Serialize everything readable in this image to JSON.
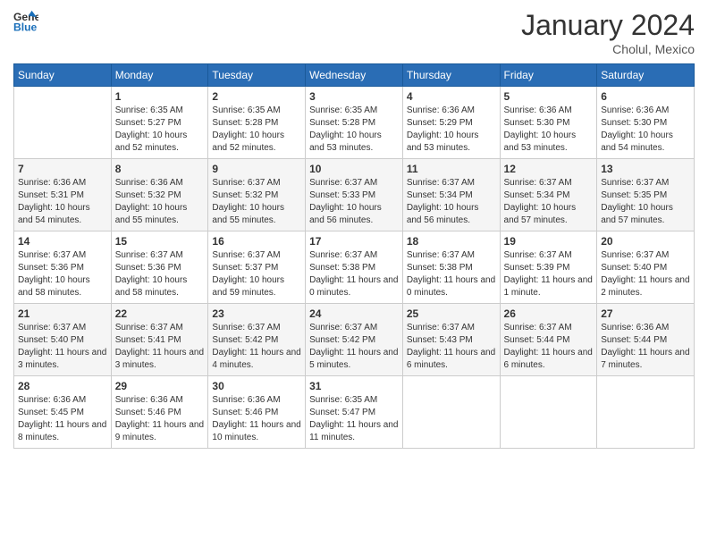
{
  "logo": {
    "general": "General",
    "blue": "Blue"
  },
  "title": {
    "month": "January 2024",
    "location": "Cholul, Mexico"
  },
  "weekdays": [
    "Sunday",
    "Monday",
    "Tuesday",
    "Wednesday",
    "Thursday",
    "Friday",
    "Saturday"
  ],
  "weeks": [
    [
      {
        "day": "",
        "empty": true
      },
      {
        "day": "1",
        "sunrise": "Sunrise: 6:35 AM",
        "sunset": "Sunset: 5:27 PM",
        "daylight": "Daylight: 10 hours and 52 minutes."
      },
      {
        "day": "2",
        "sunrise": "Sunrise: 6:35 AM",
        "sunset": "Sunset: 5:28 PM",
        "daylight": "Daylight: 10 hours and 52 minutes."
      },
      {
        "day": "3",
        "sunrise": "Sunrise: 6:35 AM",
        "sunset": "Sunset: 5:28 PM",
        "daylight": "Daylight: 10 hours and 53 minutes."
      },
      {
        "day": "4",
        "sunrise": "Sunrise: 6:36 AM",
        "sunset": "Sunset: 5:29 PM",
        "daylight": "Daylight: 10 hours and 53 minutes."
      },
      {
        "day": "5",
        "sunrise": "Sunrise: 6:36 AM",
        "sunset": "Sunset: 5:30 PM",
        "daylight": "Daylight: 10 hours and 53 minutes."
      },
      {
        "day": "6",
        "sunrise": "Sunrise: 6:36 AM",
        "sunset": "Sunset: 5:30 PM",
        "daylight": "Daylight: 10 hours and 54 minutes."
      }
    ],
    [
      {
        "day": "7",
        "sunrise": "Sunrise: 6:36 AM",
        "sunset": "Sunset: 5:31 PM",
        "daylight": "Daylight: 10 hours and 54 minutes."
      },
      {
        "day": "8",
        "sunrise": "Sunrise: 6:36 AM",
        "sunset": "Sunset: 5:32 PM",
        "daylight": "Daylight: 10 hours and 55 minutes."
      },
      {
        "day": "9",
        "sunrise": "Sunrise: 6:37 AM",
        "sunset": "Sunset: 5:32 PM",
        "daylight": "Daylight: 10 hours and 55 minutes."
      },
      {
        "day": "10",
        "sunrise": "Sunrise: 6:37 AM",
        "sunset": "Sunset: 5:33 PM",
        "daylight": "Daylight: 10 hours and 56 minutes."
      },
      {
        "day": "11",
        "sunrise": "Sunrise: 6:37 AM",
        "sunset": "Sunset: 5:34 PM",
        "daylight": "Daylight: 10 hours and 56 minutes."
      },
      {
        "day": "12",
        "sunrise": "Sunrise: 6:37 AM",
        "sunset": "Sunset: 5:34 PM",
        "daylight": "Daylight: 10 hours and 57 minutes."
      },
      {
        "day": "13",
        "sunrise": "Sunrise: 6:37 AM",
        "sunset": "Sunset: 5:35 PM",
        "daylight": "Daylight: 10 hours and 57 minutes."
      }
    ],
    [
      {
        "day": "14",
        "sunrise": "Sunrise: 6:37 AM",
        "sunset": "Sunset: 5:36 PM",
        "daylight": "Daylight: 10 hours and 58 minutes."
      },
      {
        "day": "15",
        "sunrise": "Sunrise: 6:37 AM",
        "sunset": "Sunset: 5:36 PM",
        "daylight": "Daylight: 10 hours and 58 minutes."
      },
      {
        "day": "16",
        "sunrise": "Sunrise: 6:37 AM",
        "sunset": "Sunset: 5:37 PM",
        "daylight": "Daylight: 10 hours and 59 minutes."
      },
      {
        "day": "17",
        "sunrise": "Sunrise: 6:37 AM",
        "sunset": "Sunset: 5:38 PM",
        "daylight": "Daylight: 11 hours and 0 minutes."
      },
      {
        "day": "18",
        "sunrise": "Sunrise: 6:37 AM",
        "sunset": "Sunset: 5:38 PM",
        "daylight": "Daylight: 11 hours and 0 minutes."
      },
      {
        "day": "19",
        "sunrise": "Sunrise: 6:37 AM",
        "sunset": "Sunset: 5:39 PM",
        "daylight": "Daylight: 11 hours and 1 minute."
      },
      {
        "day": "20",
        "sunrise": "Sunrise: 6:37 AM",
        "sunset": "Sunset: 5:40 PM",
        "daylight": "Daylight: 11 hours and 2 minutes."
      }
    ],
    [
      {
        "day": "21",
        "sunrise": "Sunrise: 6:37 AM",
        "sunset": "Sunset: 5:40 PM",
        "daylight": "Daylight: 11 hours and 3 minutes."
      },
      {
        "day": "22",
        "sunrise": "Sunrise: 6:37 AM",
        "sunset": "Sunset: 5:41 PM",
        "daylight": "Daylight: 11 hours and 3 minutes."
      },
      {
        "day": "23",
        "sunrise": "Sunrise: 6:37 AM",
        "sunset": "Sunset: 5:42 PM",
        "daylight": "Daylight: 11 hours and 4 minutes."
      },
      {
        "day": "24",
        "sunrise": "Sunrise: 6:37 AM",
        "sunset": "Sunset: 5:42 PM",
        "daylight": "Daylight: 11 hours and 5 minutes."
      },
      {
        "day": "25",
        "sunrise": "Sunrise: 6:37 AM",
        "sunset": "Sunset: 5:43 PM",
        "daylight": "Daylight: 11 hours and 6 minutes."
      },
      {
        "day": "26",
        "sunrise": "Sunrise: 6:37 AM",
        "sunset": "Sunset: 5:44 PM",
        "daylight": "Daylight: 11 hours and 6 minutes."
      },
      {
        "day": "27",
        "sunrise": "Sunrise: 6:36 AM",
        "sunset": "Sunset: 5:44 PM",
        "daylight": "Daylight: 11 hours and 7 minutes."
      }
    ],
    [
      {
        "day": "28",
        "sunrise": "Sunrise: 6:36 AM",
        "sunset": "Sunset: 5:45 PM",
        "daylight": "Daylight: 11 hours and 8 minutes."
      },
      {
        "day": "29",
        "sunrise": "Sunrise: 6:36 AM",
        "sunset": "Sunset: 5:46 PM",
        "daylight": "Daylight: 11 hours and 9 minutes."
      },
      {
        "day": "30",
        "sunrise": "Sunrise: 6:36 AM",
        "sunset": "Sunset: 5:46 PM",
        "daylight": "Daylight: 11 hours and 10 minutes."
      },
      {
        "day": "31",
        "sunrise": "Sunrise: 6:35 AM",
        "sunset": "Sunset: 5:47 PM",
        "daylight": "Daylight: 11 hours and 11 minutes."
      },
      {
        "day": "",
        "empty": true
      },
      {
        "day": "",
        "empty": true
      },
      {
        "day": "",
        "empty": true
      }
    ]
  ]
}
